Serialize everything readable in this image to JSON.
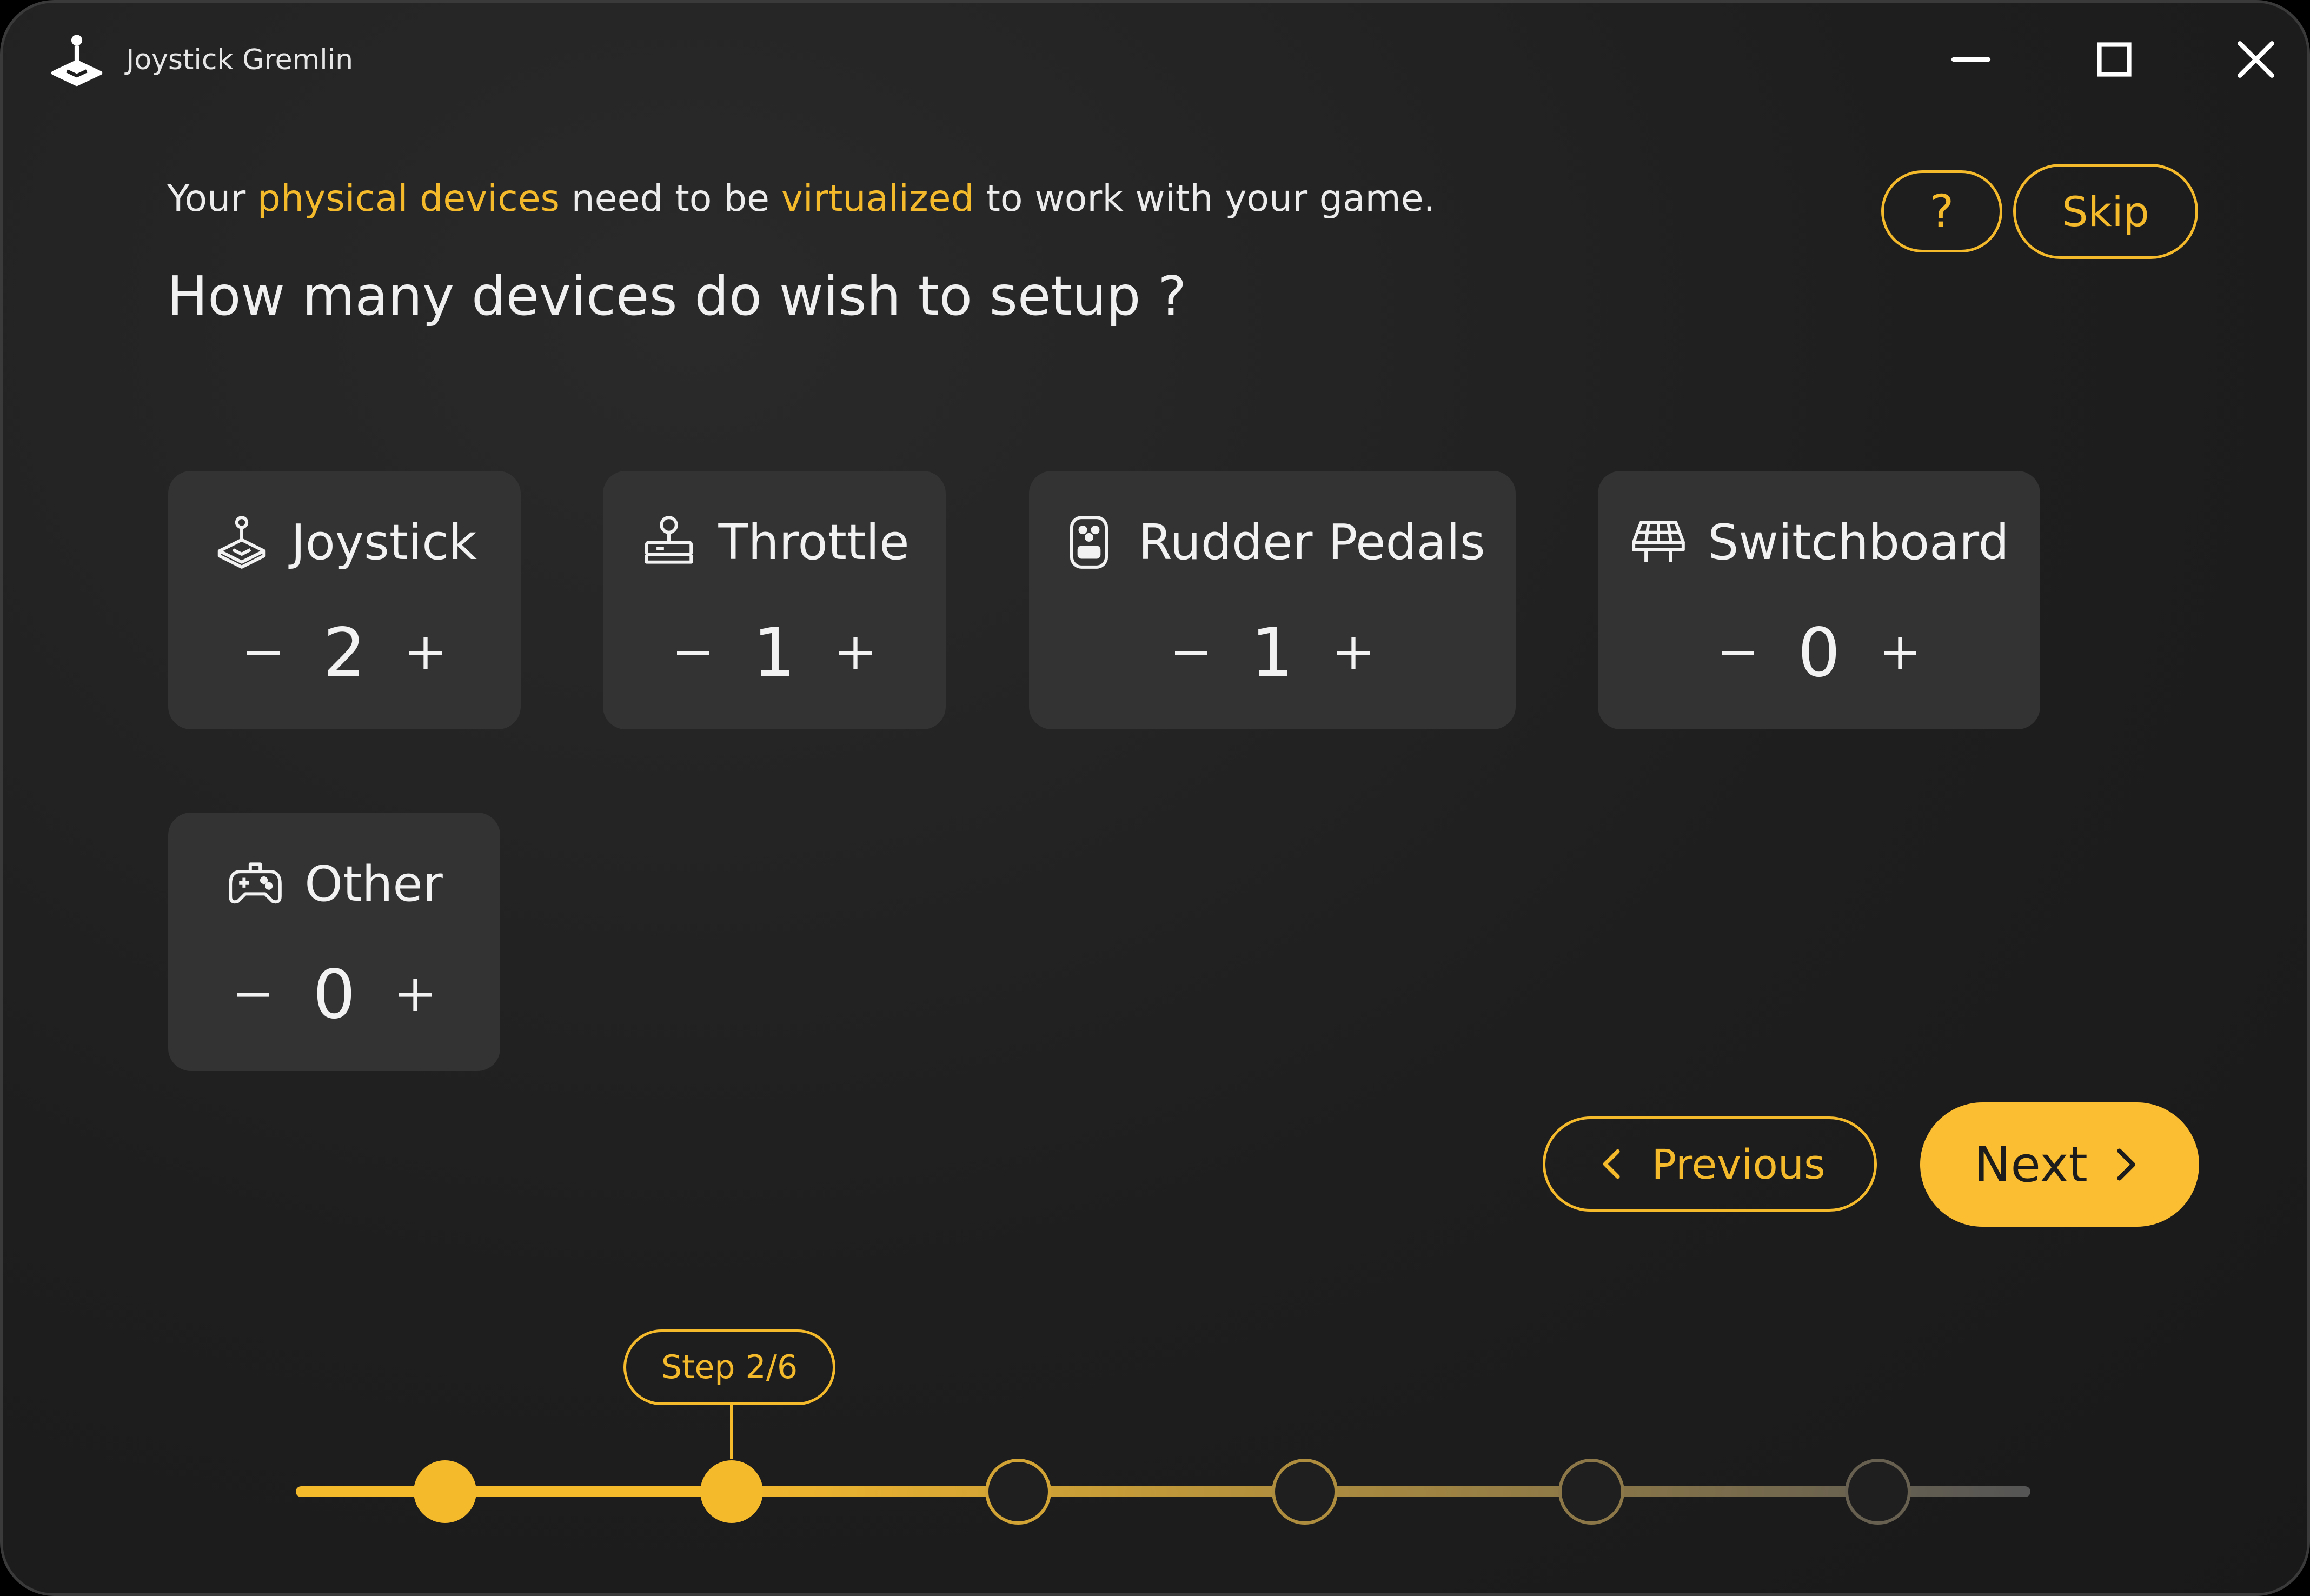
{
  "app": {
    "title": "Joystick Gremlin",
    "icon": "joystick-icon"
  },
  "window_controls": {
    "minimize": "minimize-icon",
    "maximize": "maximize-icon",
    "close": "close-icon"
  },
  "intro": {
    "part1": "Your ",
    "highlight1": "physical devices",
    "part2": " need to be ",
    "highlight2": "virtualized",
    "part3": " to work with your game."
  },
  "question": "How many devices do wish to setup ?",
  "help_button": {
    "label": "?"
  },
  "skip_button": {
    "label": "Skip"
  },
  "devices": [
    {
      "name": "Joystick",
      "icon": "joystick-icon",
      "count": "2"
    },
    {
      "name": "Throttle",
      "icon": "throttle-icon",
      "count": "1"
    },
    {
      "name": "Rudder Pedals",
      "icon": "rudder-pedals-icon",
      "count": "1"
    },
    {
      "name": "Switchboard",
      "icon": "switchboard-icon",
      "count": "0"
    },
    {
      "name": "Other",
      "icon": "gamepad-icon",
      "count": "0"
    }
  ],
  "nav": {
    "previous": "Previous",
    "next": "Next"
  },
  "progress": {
    "label": "Step 2/6",
    "current_step": 2,
    "total_steps": 6
  },
  "colors": {
    "accent": "#f5b92c",
    "next_button": "#fbbd32",
    "background": "#1e1e1e",
    "card": "#333333",
    "text": "#f2f2f2"
  }
}
